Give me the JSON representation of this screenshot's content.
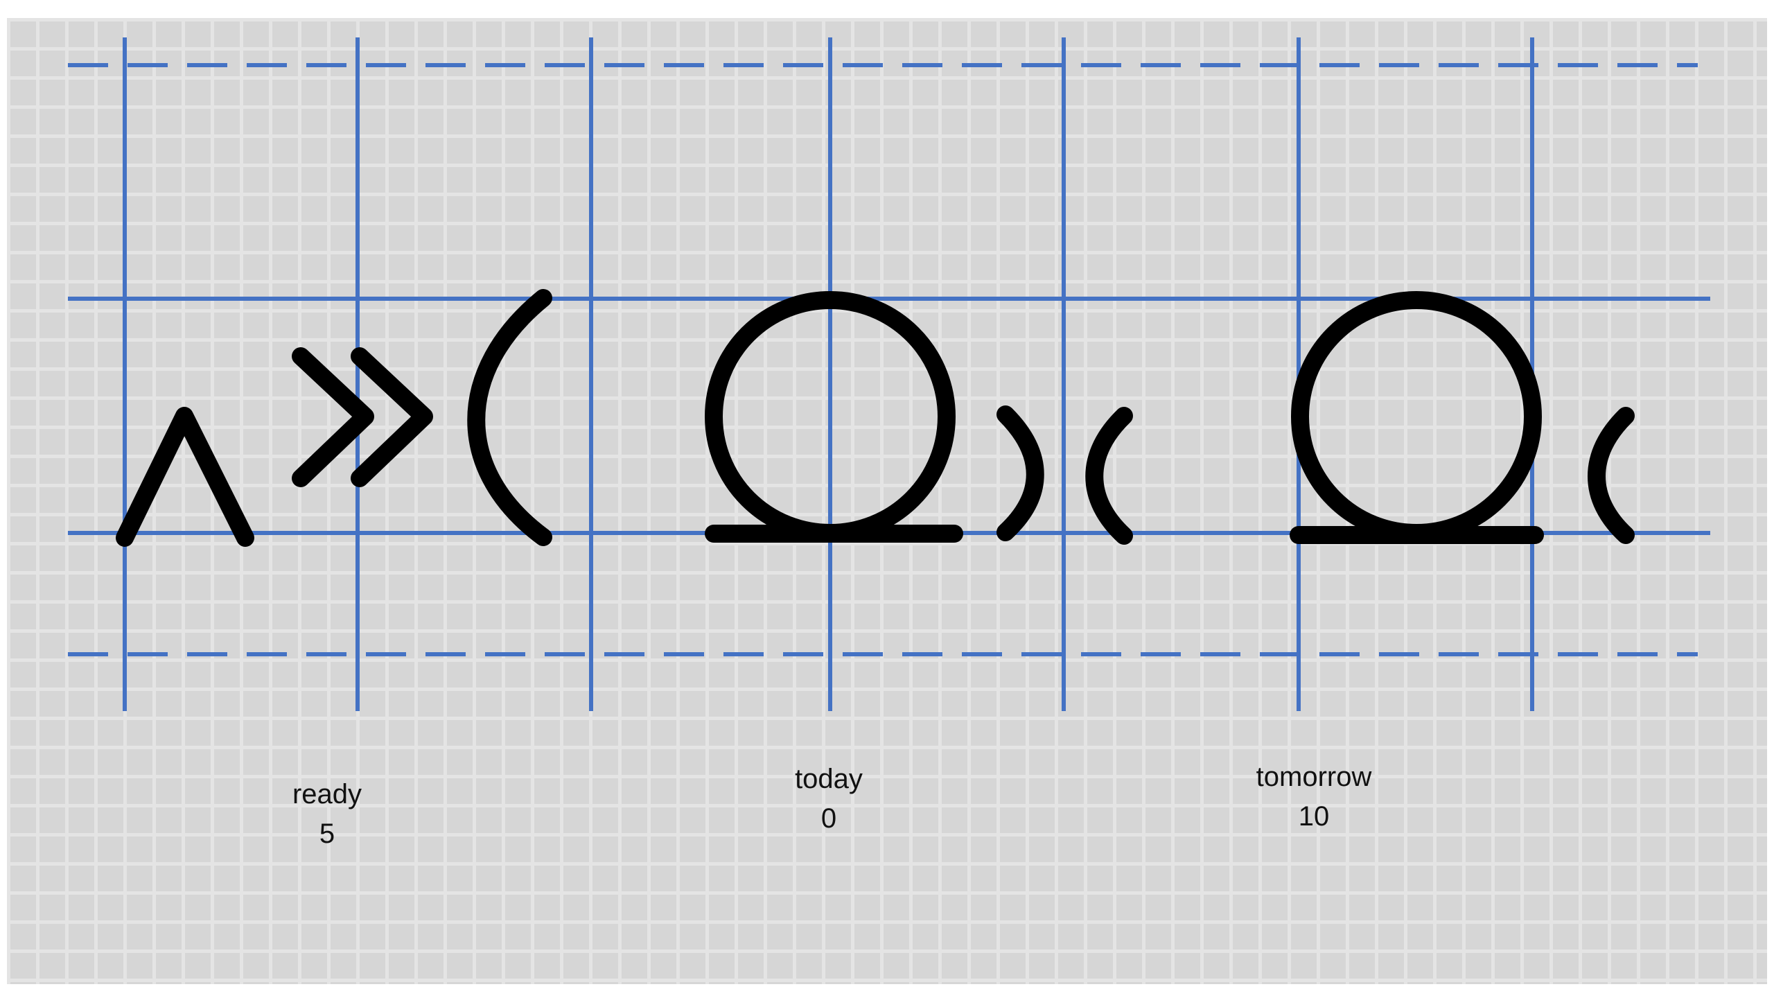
{
  "colors": {
    "guide_line": "#4472c4",
    "glyph_stroke": "#000000",
    "paper": "#d6d6d6",
    "paper_grid": "#e4e4e4"
  },
  "words": [
    {
      "label": "ready",
      "value": "5"
    },
    {
      "label": "today",
      "value": "0"
    },
    {
      "label": "tomorrow",
      "value": "10"
    }
  ]
}
